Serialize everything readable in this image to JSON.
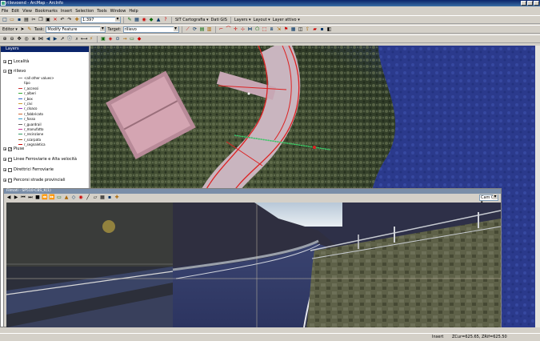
{
  "window": {
    "title": "rilievoend - ArcMap - ArcInfo"
  },
  "menu": [
    "File",
    "Edit",
    "View",
    "Bookmarks",
    "Insert",
    "Selection",
    "Tools",
    "Window",
    "Help"
  ],
  "toolbar1": {
    "scale": "1:397",
    "sit_label": "SIT Cartografia ▾",
    "sit_value": "Dati GIS",
    "layers_label": "Layers ▾",
    "layout_label": "Layout ▾",
    "layer_attivo": "Layer attivo ▾"
  },
  "editor": {
    "label": "Editor ▾",
    "task_label": "Task:",
    "task_value": "Modify Feature",
    "target_label": "Target:",
    "target_value": "rilievo"
  },
  "toc": {
    "header": "Layers",
    "layers": [
      {
        "name": "Località",
        "checked": false
      },
      {
        "name": "rilievo",
        "checked": true
      },
      {
        "name": "Piuse",
        "checked": true
      },
      {
        "name": "Linee Ferroviarie e Alta velocità",
        "checked": false
      },
      {
        "name": "Direttrici Ferroviarie",
        "checked": false
      },
      {
        "name": "Percorsi strade provinciali",
        "checked": false
      }
    ],
    "symbols": [
      {
        "label": "<all other values>",
        "color": "#888888"
      },
      {
        "label": "tipo",
        "color": "#ffffff"
      },
      {
        "label": "r_accessi",
        "color": "#cc3333"
      },
      {
        "label": "r_alberi",
        "color": "#33aa33"
      },
      {
        "label": "r_box",
        "color": "#3366cc"
      },
      {
        "label": "r_civi",
        "color": "#cc9933"
      },
      {
        "label": "r_cloaco",
        "color": "#9933cc"
      },
      {
        "label": "r_fabbricato",
        "color": "#cc6633"
      },
      {
        "label": "r_fosso",
        "color": "#3399cc"
      },
      {
        "label": "r_guardrail",
        "color": "#666666"
      },
      {
        "label": "r_manufatto",
        "color": "#cc3399"
      },
      {
        "label": "r_recinzione",
        "color": "#339966"
      },
      {
        "label": "r_scarpata",
        "color": "#996633"
      },
      {
        "label": "r_segnaletica",
        "color": "#cc0000"
      }
    ]
  },
  "viewer": {
    "title": "Filmati - SP510-CBS_K(1)",
    "cam": "Cam 07 ▾"
  },
  "status": {
    "mode": "Insert",
    "coords": "ZCur=625.65, ZRif=625.50"
  },
  "colors": {
    "accent": "#0a246a",
    "chrome": "#d4d0c8"
  }
}
